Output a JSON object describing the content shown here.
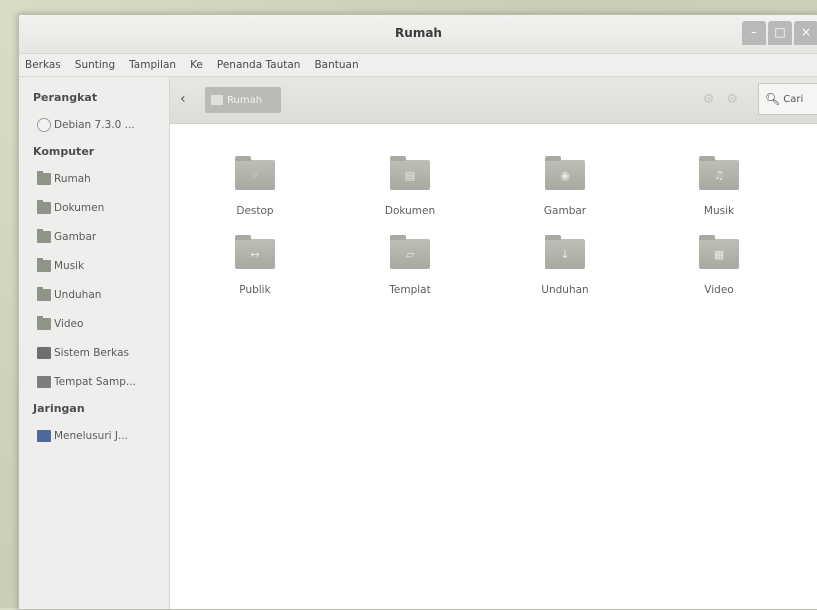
{
  "window": {
    "title": "Rumah",
    "controls": [
      "–",
      "□",
      "×"
    ]
  },
  "menubar": [
    "Berkas",
    "Sunting",
    "Tampilan",
    "Ke",
    "Penanda Tautan",
    "Bantuan"
  ],
  "sidebar": {
    "sections": [
      {
        "heading": "Perangkat",
        "items": [
          {
            "label": "Debian 7.3.0 ...",
            "icon": "disc-icon"
          }
        ]
      },
      {
        "heading": "Komputer",
        "items": [
          {
            "label": "Rumah",
            "icon": "folder-icon"
          },
          {
            "label": "Dokumen",
            "icon": "folder-icon"
          },
          {
            "label": "Gambar",
            "icon": "folder-icon"
          },
          {
            "label": "Musik",
            "icon": "folder-icon"
          },
          {
            "label": "Unduhan",
            "icon": "folder-icon"
          },
          {
            "label": "Video",
            "icon": "folder-icon"
          },
          {
            "label": "Sistem Berkas",
            "icon": "drive-icon"
          },
          {
            "label": "Tempat Samp...",
            "icon": "trash-icon"
          }
        ]
      },
      {
        "heading": "Jaringan",
        "items": [
          {
            "label": "Menelusuri J...",
            "icon": "network-icon"
          }
        ]
      }
    ]
  },
  "toolbar": {
    "back": "‹",
    "breadcrumb": "Rumah",
    "search_label": "Cari"
  },
  "files": [
    {
      "label": "Destop",
      "emblem": "◦"
    },
    {
      "label": "Dokumen",
      "emblem": "▤"
    },
    {
      "label": "Gambar",
      "emblem": "◉"
    },
    {
      "label": "Musik",
      "emblem": "♫"
    },
    {
      "label": "Publik",
      "emblem": "↔"
    },
    {
      "label": "Templat",
      "emblem": "▱"
    },
    {
      "label": "Unduhan",
      "emblem": "↓"
    },
    {
      "label": "Video",
      "emblem": "▦"
    }
  ]
}
